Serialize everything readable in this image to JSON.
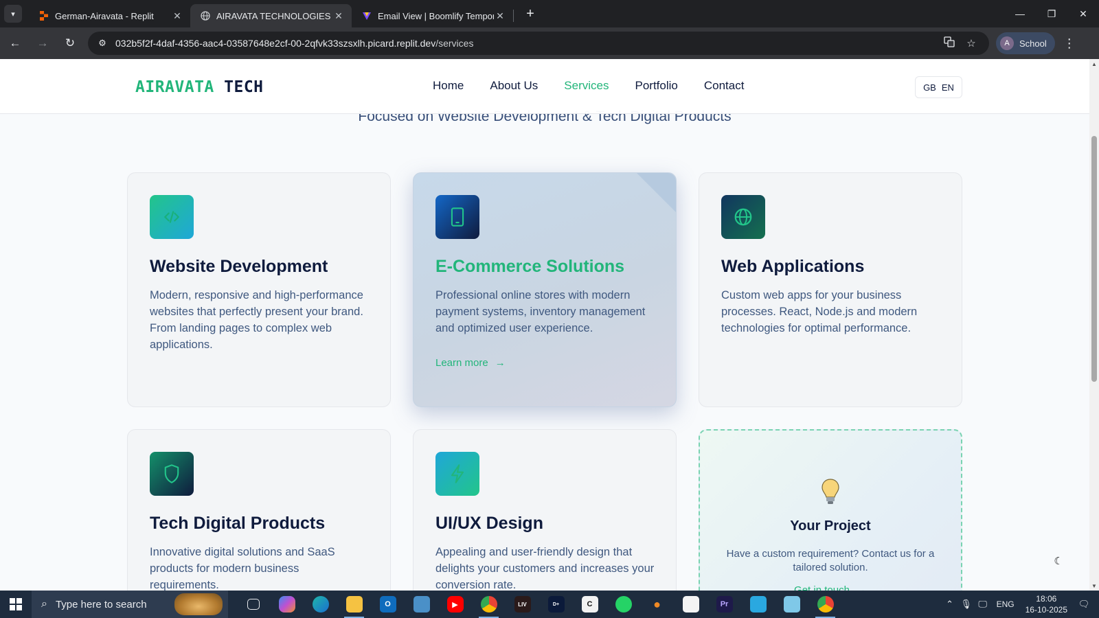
{
  "browser": {
    "tabs": [
      {
        "title": "German-Airavata - Replit",
        "active": false
      },
      {
        "title": "AIRAVATA TECHNOLOGIES - Cu",
        "active": true
      },
      {
        "title": "Email View | Boomlify Temporar",
        "active": false
      }
    ],
    "url_host": "032b5f2f-4daf-4356-aac4-03587648e2cf-00-2qfvk33szsxlh.picard.replit.dev",
    "url_path": "/services",
    "profile_initial": "A",
    "profile_label": "School"
  },
  "site": {
    "logo_part1": "AIRAVATA",
    "logo_part2": "TECH",
    "nav": [
      "Home",
      "About Us",
      "Services",
      "Portfolio",
      "Contact"
    ],
    "nav_active": "Services",
    "lang_flag": "GB",
    "lang_code": "EN",
    "subtitle": "Focused on Website Development & Tech Digital Products",
    "services": [
      {
        "title": "Website Development",
        "desc": "Modern, responsive and high-performance websites that perfectly present your brand. From landing pages to complex web applications.",
        "icon": "code-icon"
      },
      {
        "title": "E-Commerce Solutions",
        "desc": "Professional online stores with modern payment systems, inventory management and optimized user experience.",
        "icon": "tablet-icon",
        "link": "Learn more"
      },
      {
        "title": "Web Applications",
        "desc": "Custom web apps for your business processes. React, Node.js and modern technologies for optimal performance.",
        "icon": "globe-icon"
      },
      {
        "title": "Tech Digital Products",
        "desc": "Innovative digital solutions and SaaS products for modern business requirements.",
        "icon": "shield-icon"
      },
      {
        "title": "UI/UX Design",
        "desc": "Appealing and user-friendly design that delights your customers and increases your conversion rate.",
        "icon": "lightning-icon"
      }
    ],
    "project_card": {
      "title": "Your Project",
      "desc": "Have a custom requirement? Contact us for a tailored solution.",
      "link": "Get in touch"
    },
    "colors": {
      "accent": "#22b57a",
      "navy": "#0f1b3d",
      "text": "#3f587f"
    }
  },
  "taskbar": {
    "search_placeholder": "Type here to search",
    "language": "ENG",
    "time": "18:06",
    "date": "16-10-2025"
  }
}
